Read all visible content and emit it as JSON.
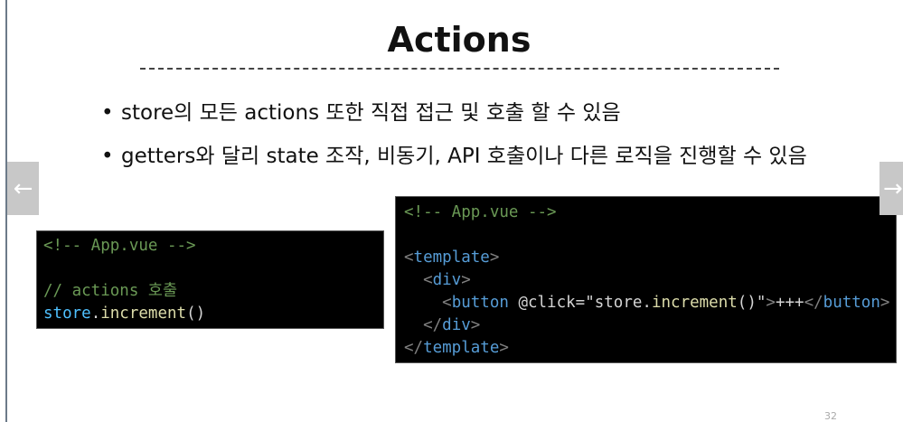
{
  "slide": {
    "title": "Actions",
    "bullets": [
      {
        "bullet": "•",
        "text": "store의 모든 actions 또한 직접 접근 및 호출 할 수 있음"
      },
      {
        "bullet": "•",
        "text": "getters와 달리 state 조작, 비동기, API 호출이나 다른 로직을 진행할 수 있음"
      }
    ],
    "page_number": "32"
  },
  "code_left": [
    [
      {
        "t": "<!-- App.vue -->",
        "c": "comment"
      }
    ],
    [
      {
        "t": " ",
        "c": "plain"
      }
    ],
    [
      {
        "t": "// actions 호출",
        "c": "comment"
      }
    ],
    [
      {
        "t": "store",
        "c": "var"
      },
      {
        "t": ".",
        "c": "plain"
      },
      {
        "t": "increment",
        "c": "fn"
      },
      {
        "t": "()",
        "c": "plain"
      }
    ]
  ],
  "code_right": [
    [
      {
        "t": "<!-- App.vue -->",
        "c": "comment"
      }
    ],
    [
      {
        "t": " ",
        "c": "plain"
      }
    ],
    [
      {
        "t": "<",
        "c": "punc"
      },
      {
        "t": "template",
        "c": "tag"
      },
      {
        "t": ">",
        "c": "punc"
      }
    ],
    [
      {
        "t": "  <",
        "c": "punc"
      },
      {
        "t": "div",
        "c": "tag"
      },
      {
        "t": ">",
        "c": "punc"
      }
    ],
    [
      {
        "t": "    <",
        "c": "punc"
      },
      {
        "t": "button",
        "c": "tag"
      },
      {
        "t": " @click=\"",
        "c": "plain"
      },
      {
        "t": "store",
        "c": "plain"
      },
      {
        "t": ".",
        "c": "plain"
      },
      {
        "t": "increment",
        "c": "fn"
      },
      {
        "t": "()",
        "c": "plain"
      },
      {
        "t": "\"",
        "c": "plain"
      },
      {
        "t": ">",
        "c": "punc"
      },
      {
        "t": "+++",
        "c": "plain"
      },
      {
        "t": "</",
        "c": "punc"
      },
      {
        "t": "button",
        "c": "tag"
      },
      {
        "t": ">",
        "c": "punc"
      }
    ],
    [
      {
        "t": "  </",
        "c": "punc"
      },
      {
        "t": "div",
        "c": "tag"
      },
      {
        "t": ">",
        "c": "punc"
      }
    ],
    [
      {
        "t": "</",
        "c": "punc"
      },
      {
        "t": "template",
        "c": "tag"
      },
      {
        "t": ">",
        "c": "punc"
      }
    ]
  ],
  "nav": {
    "prev_icon": "arrow-left-icon",
    "prev": "←",
    "next_icon": "arrow-right-icon",
    "next": "→"
  }
}
